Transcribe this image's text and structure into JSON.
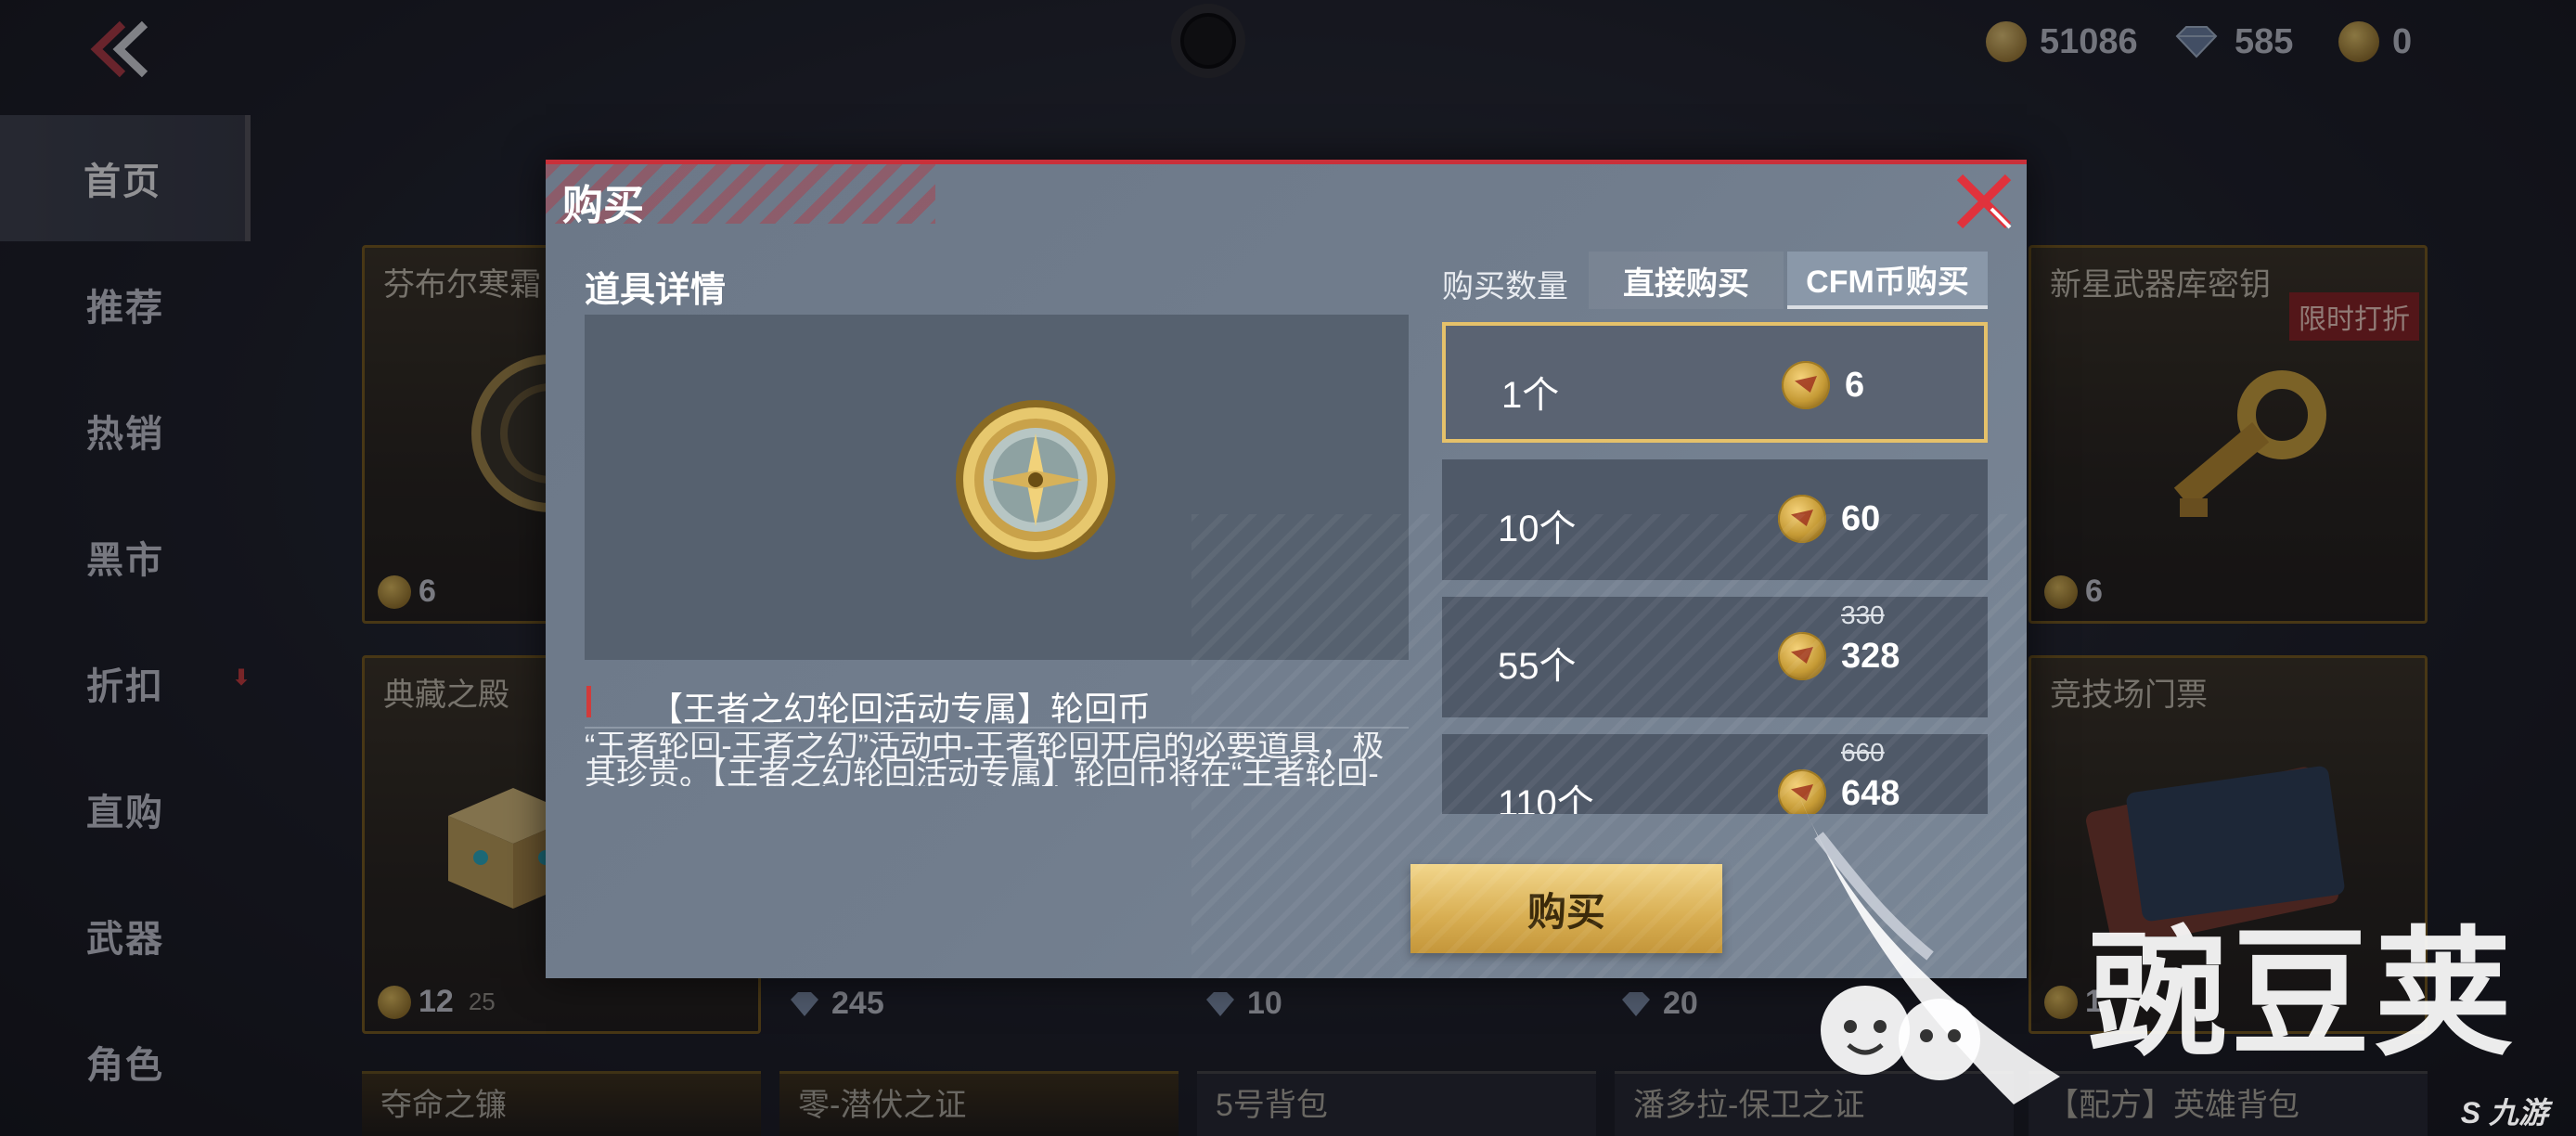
{
  "topbar": {
    "gold_amount": "51086",
    "diamond_amount": "585",
    "cfm_amount": "0"
  },
  "sidebar": {
    "items": [
      {
        "label": "首页"
      },
      {
        "label": "推荐"
      },
      {
        "label": "热销"
      },
      {
        "label": "黑市"
      },
      {
        "label": "折扣"
      },
      {
        "label": "直购"
      },
      {
        "label": "武器"
      },
      {
        "label": "角色"
      }
    ],
    "active_index": 0
  },
  "shop": {
    "cards": [
      {
        "title": "芬布尔寒霜",
        "price": "6"
      },
      {
        "title": "新星武器库密钥",
        "price": "6",
        "badge": "限时打折"
      },
      {
        "title": "典藏之殿",
        "price": "12",
        "sub": "25"
      },
      {
        "title": "竞技场门票",
        "price": "1"
      }
    ],
    "middle_prices": [
      "245",
      "10",
      "20"
    ],
    "bottom_row": [
      "夺命之镰",
      "零-潜伏之证",
      "5号背包",
      "潘多拉-保卫之证",
      "【配方】英雄背包"
    ]
  },
  "modal": {
    "title": "购买",
    "details_label": "道具详情",
    "item_name": "【王者之幻轮回活动专属】轮回币",
    "item_description": "“王者轮回-王者之幻”活动中-王者轮回开启的必要道具，极其珍贵。【王者之幻轮回活动专属】轮回币将在“王者轮回-王者之幻”活动下架后过期，请尽快使用。",
    "qty_label": "购买数量",
    "tabs": [
      {
        "label": "直接购买"
      },
      {
        "label": "CFM币购买"
      }
    ],
    "active_tab": 1,
    "options": [
      {
        "qty": "1个",
        "price": "6",
        "old_price": ""
      },
      {
        "qty": "10个",
        "price": "60",
        "old_price": ""
      },
      {
        "qty": "55个",
        "price": "328",
        "old_price": "330"
      },
      {
        "qty": "110个",
        "price": "648",
        "old_price": "660"
      }
    ],
    "selected_option": 0,
    "buy_label": "购买"
  },
  "watermark": {
    "brand_text": "豌豆荚",
    "corner_text": "九游"
  },
  "colors": {
    "accent_red": "#c9303a",
    "selected_gold": "#e5c16a",
    "buy_button": "#d8ae52"
  }
}
